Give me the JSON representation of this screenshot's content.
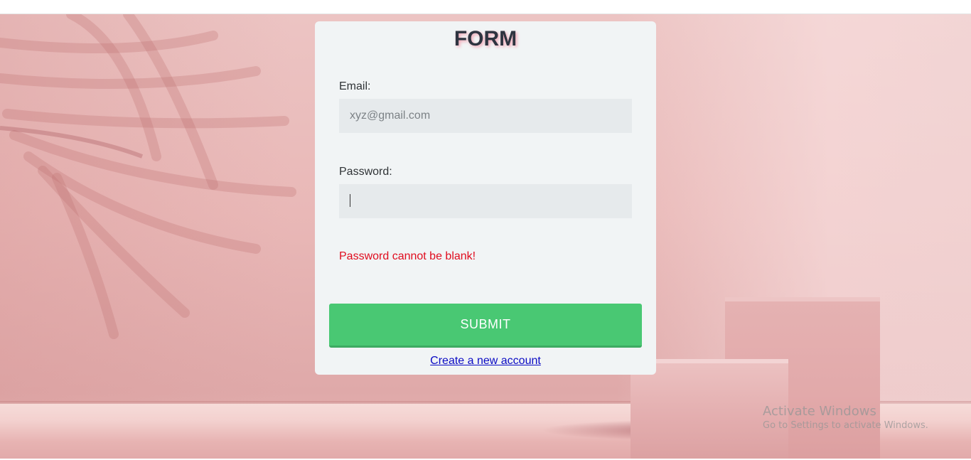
{
  "form": {
    "title": "FORM",
    "email": {
      "label": "Email:",
      "value": "",
      "placeholder": "xyz@gmail.com"
    },
    "password": {
      "label": "Password:",
      "value": "",
      "placeholder": ""
    },
    "error": "Password cannot be blank!",
    "submit_label": "SUBMIT",
    "create_account_link": "Create a new account"
  },
  "watermark": {
    "title": "Activate Windows",
    "subtitle": "Go to Settings to activate Windows."
  },
  "colors": {
    "submit_green": "#49c873",
    "error_red": "#e00c1e",
    "link_blue": "#0b0bc4",
    "card_bg": "#f1f4f5"
  }
}
